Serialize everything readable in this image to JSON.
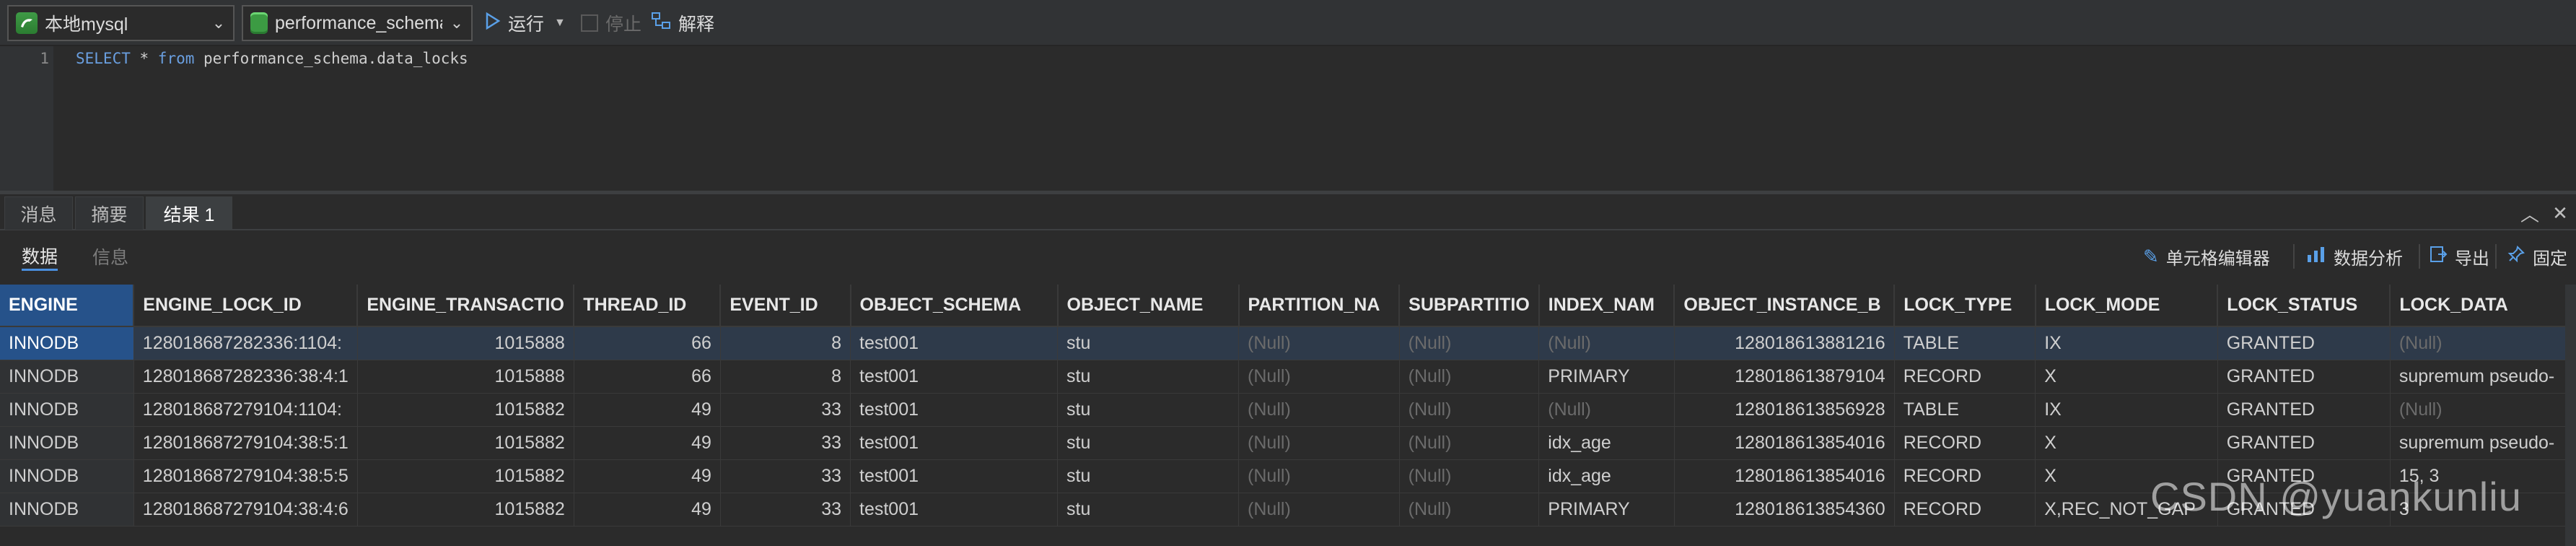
{
  "toolbar": {
    "connection": "本地mysql",
    "database": "performance_schema",
    "run_label": "运行",
    "stop_label": "停止",
    "explain_label": "解释"
  },
  "editor": {
    "line_number": "1",
    "kw_select": "SELECT",
    "star": " * ",
    "kw_from": "from",
    "rest": " performance_schema.data_locks"
  },
  "tabs": [
    {
      "label": "消息"
    },
    {
      "label": "摘要"
    },
    {
      "label": "结果 1"
    }
  ],
  "subtabs": {
    "data": "数据",
    "info": "信息"
  },
  "tools": {
    "cell_editor": "单元格编辑器",
    "analysis": "数据分析",
    "export": "导出",
    "pin": "固定"
  },
  "columns": [
    "ENGINE",
    "ENGINE_LOCK_ID",
    "ENGINE_TRANSACTIO",
    "THREAD_ID",
    "EVENT_ID",
    "OBJECT_SCHEMA",
    "OBJECT_NAME",
    "PARTITION_NA",
    "SUBPARTITIO",
    "INDEX_NAM",
    "OBJECT_INSTANCE_B",
    "LOCK_TYPE",
    "LOCK_MODE",
    "LOCK_STATUS",
    "LOCK_DATA"
  ],
  "rows": [
    [
      "INNODB",
      "128018687282336:1104:",
      "1015888",
      "66",
      "8",
      "test001",
      "stu",
      "(Null)",
      "(Null)",
      "(Null)",
      "128018613881216",
      "TABLE",
      "IX",
      "GRANTED",
      "(Null)"
    ],
    [
      "INNODB",
      "128018687282336:38:4:1",
      "1015888",
      "66",
      "8",
      "test001",
      "stu",
      "(Null)",
      "(Null)",
      "PRIMARY",
      "128018613879104",
      "RECORD",
      "X",
      "GRANTED",
      "supremum pseudo-"
    ],
    [
      "INNODB",
      "128018687279104:1104:",
      "1015882",
      "49",
      "33",
      "test001",
      "stu",
      "(Null)",
      "(Null)",
      "(Null)",
      "128018613856928",
      "TABLE",
      "IX",
      "GRANTED",
      "(Null)"
    ],
    [
      "INNODB",
      "128018687279104:38:5:1",
      "1015882",
      "49",
      "33",
      "test001",
      "stu",
      "(Null)",
      "(Null)",
      "idx_age",
      "128018613854016",
      "RECORD",
      "X",
      "GRANTED",
      "supremum pseudo-"
    ],
    [
      "INNODB",
      "128018687279104:38:5:5",
      "1015882",
      "49",
      "33",
      "test001",
      "stu",
      "(Null)",
      "(Null)",
      "idx_age",
      "128018613854016",
      "RECORD",
      "X",
      "GRANTED",
      "15, 3"
    ],
    [
      "INNODB",
      "128018687279104:38:4:6",
      "1015882",
      "49",
      "33",
      "test001",
      "stu",
      "(Null)",
      "(Null)",
      "PRIMARY",
      "128018613854360",
      "RECORD",
      "X,REC_NOT_GAP",
      "GRANTED",
      "3"
    ]
  ],
  "watermark": "CSDN @yuankunliu"
}
